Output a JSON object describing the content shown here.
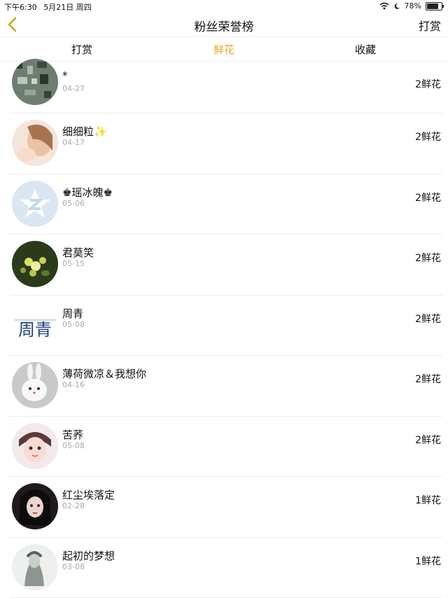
{
  "status": {
    "time": "下午6:30",
    "date": "5月21日 周四",
    "battery": "78%",
    "battery_level": 0.78
  },
  "nav": {
    "title": "粉丝荣誉榜",
    "right_label": "打赏"
  },
  "tabs": [
    {
      "label": "打赏",
      "active": false
    },
    {
      "label": "鲜花",
      "active": true
    },
    {
      "label": "收藏",
      "active": false
    }
  ],
  "colors": {
    "accent": "#e8a92b"
  },
  "fans": [
    {
      "name": "*",
      "date": "04-27",
      "count": "2鲜花"
    },
    {
      "name": "细细粒✨",
      "date": "04-17",
      "count": "2鲜花"
    },
    {
      "name": "♚瑶冰魄♚",
      "date": "05-06",
      "count": "2鲜花"
    },
    {
      "name": "君莫笑",
      "date": "05-15",
      "count": "2鲜花"
    },
    {
      "name": "周青",
      "date": "05-08",
      "count": "2鲜花"
    },
    {
      "name": "薄荷微凉＆我想你",
      "date": "04-16",
      "count": "2鲜花"
    },
    {
      "name": "苦荞",
      "date": "05-08",
      "count": "2鲜花"
    },
    {
      "name": "红尘埃落定",
      "date": "02-28",
      "count": "1鲜花"
    },
    {
      "name": "起初的梦想",
      "date": "03-08",
      "count": "1鲜花"
    }
  ],
  "avatar_texts": {
    "zhouqing": "周青"
  }
}
